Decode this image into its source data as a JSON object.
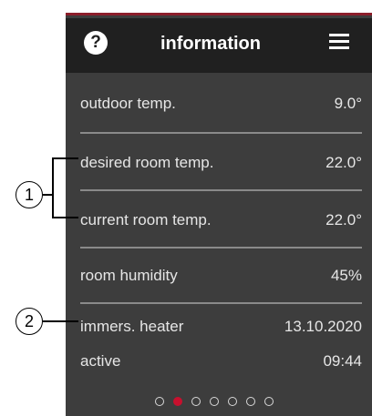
{
  "header": {
    "title": "information",
    "help_icon": "question-icon",
    "menu_icon": "hamburger-menu-icon"
  },
  "rows": [
    {
      "label": "outdoor temp.",
      "value": "9.0°"
    },
    {
      "label": "desired room temp.",
      "value": "22.0°"
    },
    {
      "label": "current room temp.",
      "value": "22.0°"
    },
    {
      "label": "room humidity",
      "value": "45%"
    },
    {
      "label": "immers. heater",
      "value": "13.10.2020",
      "label2": "active",
      "value2": "09:44"
    }
  ],
  "pager": {
    "count": 7,
    "active_index": 1
  },
  "callouts": [
    "1",
    "2"
  ],
  "colors": {
    "accent": "#c8102e",
    "header_bg": "#202020",
    "panel_bg": "#3d3d3d"
  }
}
